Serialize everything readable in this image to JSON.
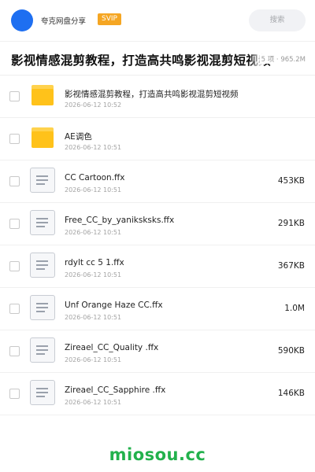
{
  "header": {
    "brand": "夸克网盘分享",
    "badge": "SVIP",
    "search_placeholder": "搜索"
  },
  "title_bar": {
    "title": "影视情感混剪教程，打造高共鸣影视混剪短视频",
    "meta": "5 项 · 965.2M"
  },
  "items": [
    {
      "type": "folder",
      "name": "影视情感混剪教程，打造高共鸣影视混剪短视频",
      "date": "2026-06-12 10:52",
      "size": ""
    },
    {
      "type": "folder",
      "name": "AE调色",
      "date": "2026-06-12 10:51",
      "size": ""
    },
    {
      "type": "file",
      "name": "CC Cartoon.ffx",
      "date": "2026-06-12 10:51",
      "size": "453KB"
    },
    {
      "type": "file",
      "name": "Free_CC_by_yaniksksks.ffx",
      "date": "2026-06-12 10:51",
      "size": "291KB"
    },
    {
      "type": "file",
      "name": "rdylt cc 5 1.ffx",
      "date": "2026-06-12 10:51",
      "size": "367KB"
    },
    {
      "type": "file",
      "name": "Unf Orange Haze CC.ffx",
      "date": "2026-06-12 10:51",
      "size": "1.0M"
    },
    {
      "type": "file",
      "name": "Zireael_CC_Quality .ffx",
      "date": "2026-06-12 10:51",
      "size": "590KB"
    },
    {
      "type": "file",
      "name": "Zireael_CC_Sapphire .ffx",
      "date": "2026-06-12 10:51",
      "size": "146KB"
    }
  ],
  "watermark": "miosou.cc",
  "colors": {
    "accent": "#1e6ff1",
    "badge": "#f5a623",
    "folder": "#ffc21a",
    "watermark": "#22b14c"
  },
  "icons": {
    "folder": "folder-icon",
    "file": "file-icon"
  }
}
